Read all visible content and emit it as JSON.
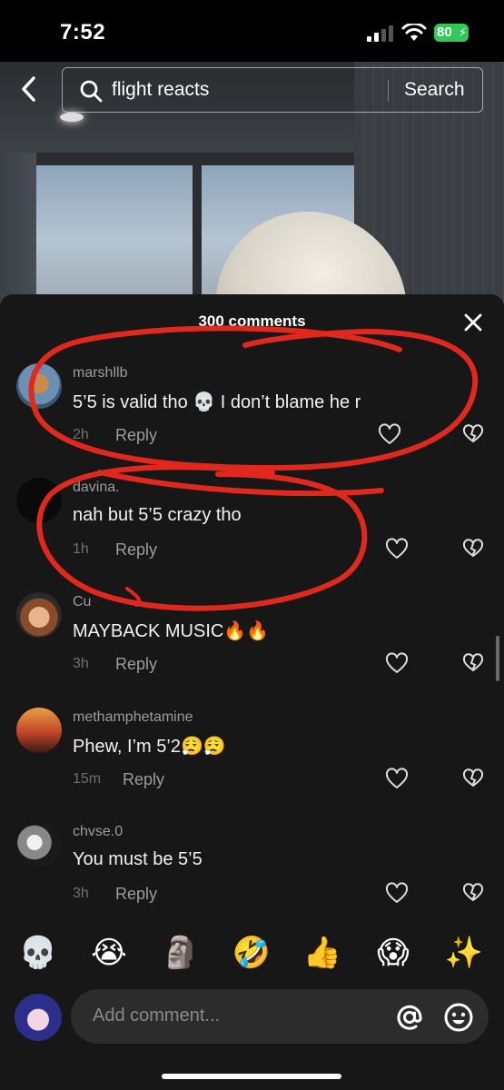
{
  "status_bar": {
    "time": "7:52",
    "battery": "80"
  },
  "search": {
    "query": "flight reacts",
    "button_label": "Search"
  },
  "comments_sheet": {
    "title": "300 comments",
    "comments": [
      {
        "username": "marshllb",
        "text": "5’5 is valid tho 💀 I don’t blame he r",
        "time": "2h",
        "reply_label": "Reply"
      },
      {
        "username": "davina.",
        "text": "nah but 5’5 crazy tho",
        "time": "1h",
        "reply_label": "Reply"
      },
      {
        "username": "Cu",
        "text": "MAYBACK MUSIC🔥🔥",
        "time": "3h",
        "reply_label": "Reply"
      },
      {
        "username": "methamphetamine",
        "text": "Phew, I’m 5’2😮‍💨😮‍💨",
        "time": "15m",
        "reply_label": "Reply"
      },
      {
        "username": "chvse.0",
        "text": "You must be 5’5",
        "time": "3h",
        "reply_label": "Reply"
      }
    ]
  },
  "emoji_bar": [
    "💀",
    "😭",
    "🗿",
    "🤣",
    "👍",
    "😱",
    "✨"
  ],
  "composer": {
    "placeholder": "Add comment..."
  },
  "colors": {
    "sheet_bg": "#171717",
    "annotation": "#e0281c",
    "battery": "#34c759"
  }
}
